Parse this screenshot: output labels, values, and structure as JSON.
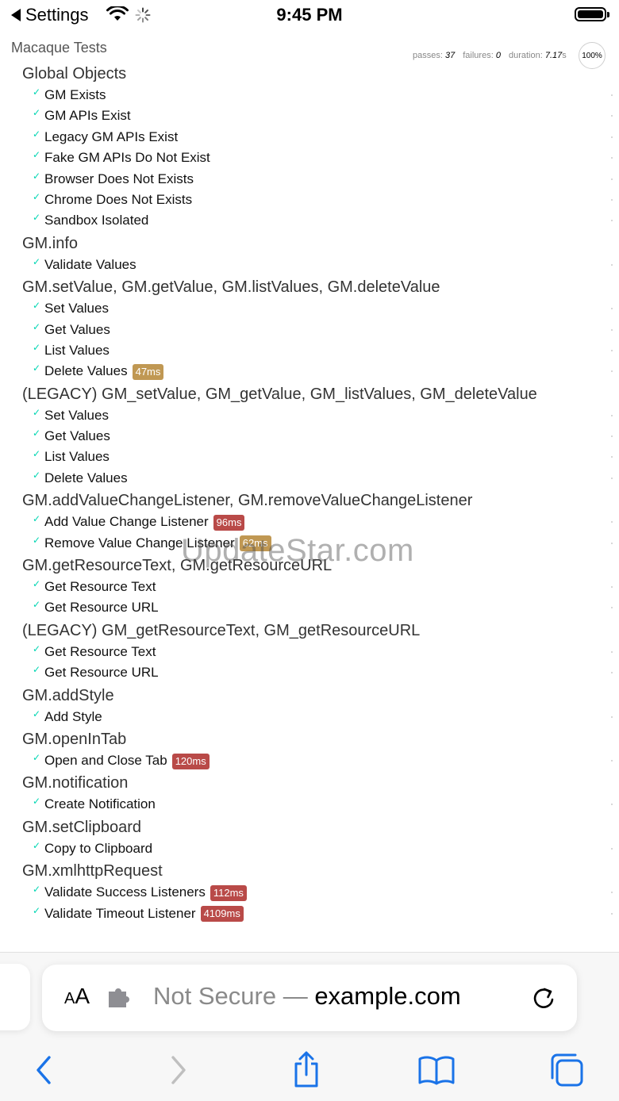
{
  "status_bar": {
    "back_app": "Settings",
    "time": "9:45 PM"
  },
  "header": {
    "title": "Macaque Tests",
    "passes_label": "passes:",
    "passes": "37",
    "failures_label": "failures:",
    "failures": "0",
    "duration_label": "duration:",
    "duration": "7.17",
    "duration_unit": "s",
    "progress": "100%"
  },
  "suites": [
    {
      "title": "Global Objects",
      "tests": [
        {
          "name": "GM Exists"
        },
        {
          "name": "GM APIs Exist"
        },
        {
          "name": "Legacy GM APIs Exist"
        },
        {
          "name": "Fake GM APIs Do Not Exist"
        },
        {
          "name": "Browser Does Not Exists"
        },
        {
          "name": "Chrome Does Not Exists"
        },
        {
          "name": "Sandbox Isolated"
        }
      ]
    },
    {
      "title": "GM.info",
      "tests": [
        {
          "name": "Validate Values"
        }
      ]
    },
    {
      "title": "GM.setValue, GM.getValue, GM.listValues, GM.deleteValue",
      "tests": [
        {
          "name": "Set Values"
        },
        {
          "name": "Get Values"
        },
        {
          "name": "List Values"
        },
        {
          "name": "Delete Values",
          "duration": "47ms",
          "speed": "medium"
        }
      ]
    },
    {
      "title": "(LEGACY) GM_setValue, GM_getValue, GM_listValues, GM_deleteValue",
      "tests": [
        {
          "name": "Set Values"
        },
        {
          "name": "Get Values"
        },
        {
          "name": "List Values"
        },
        {
          "name": "Delete Values"
        }
      ]
    },
    {
      "title": "GM.addValueChangeListener, GM.removeValueChangeListener",
      "tests": [
        {
          "name": "Add Value Change Listener",
          "duration": "96ms",
          "speed": "slow"
        },
        {
          "name": "Remove Value Change Listener",
          "duration": "62ms",
          "speed": "medium"
        }
      ]
    },
    {
      "title": "GM.getResourceText, GM.getResourceURL",
      "tests": [
        {
          "name": "Get Resource Text"
        },
        {
          "name": "Get Resource URL"
        }
      ]
    },
    {
      "title": "(LEGACY) GM_getResourceText, GM_getResourceURL",
      "tests": [
        {
          "name": "Get Resource Text"
        },
        {
          "name": "Get Resource URL"
        }
      ]
    },
    {
      "title": "GM.addStyle",
      "tests": [
        {
          "name": "Add Style"
        }
      ]
    },
    {
      "title": "GM.openInTab",
      "tests": [
        {
          "name": "Open and Close Tab",
          "duration": "120ms",
          "speed": "slow"
        }
      ]
    },
    {
      "title": "GM.notification",
      "tests": [
        {
          "name": "Create Notification"
        }
      ]
    },
    {
      "title": "GM.setClipboard",
      "tests": [
        {
          "name": "Copy to Clipboard"
        }
      ]
    },
    {
      "title": "GM.xmlhttpRequest",
      "tests": [
        {
          "name": "Validate Success Listeners",
          "duration": "112ms",
          "speed": "slow"
        },
        {
          "name": "Validate Timeout Listener",
          "duration": "4109ms",
          "speed": "slow"
        }
      ]
    }
  ],
  "watermark": "UpdateStar.com",
  "address_bar": {
    "aa_small": "A",
    "aa_large": "A",
    "security": "Not Secure",
    "separator": " — ",
    "domain": "example.com"
  },
  "colors": {
    "pass_check": "#00d6b2",
    "badge_medium": "#c09853",
    "badge_slow": "#b94a48",
    "toolbar_active": "#1a73e8",
    "toolbar_disabled": "#bfbfbf"
  },
  "icons": [
    "wifi-icon",
    "activity-spinner-icon",
    "battery-icon",
    "extension-puzzle-icon",
    "reload-icon",
    "back-arrow-icon",
    "forward-arrow-icon",
    "share-icon",
    "bookmarks-icon",
    "tabs-icon"
  ]
}
